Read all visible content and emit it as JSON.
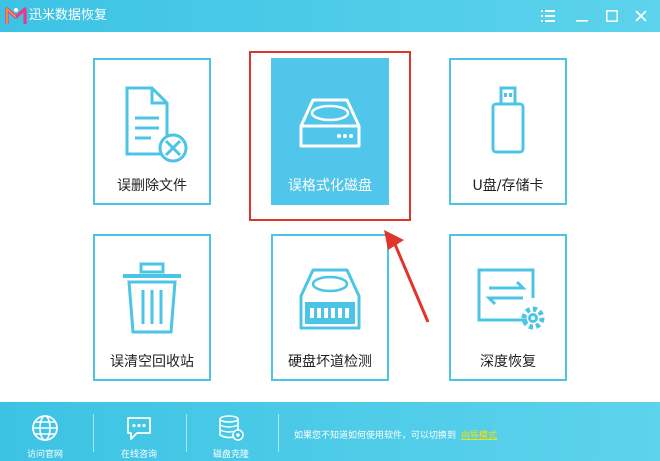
{
  "app": {
    "title": "迅米数据恢复"
  },
  "colors": {
    "accent": "#4cc4e6",
    "selected_fill": "#50c6ea",
    "highlight": "#e0352b",
    "link": "#f7e100"
  },
  "window_controls": [
    {
      "name": "menu",
      "icon": "hamburger-menu-icon"
    },
    {
      "name": "minimize",
      "icon": "minimize-icon"
    },
    {
      "name": "maximize",
      "icon": "maximize-icon"
    },
    {
      "name": "close",
      "icon": "close-icon"
    }
  ],
  "tiles": [
    {
      "label": "误删除文件",
      "icon": "deleted-file-icon",
      "selected": false
    },
    {
      "label": "误格式化磁盘",
      "icon": "hard-drive-icon",
      "selected": true
    },
    {
      "label": "U盘/存储卡",
      "icon": "usb-drive-icon",
      "selected": false
    },
    {
      "label": "误清空回收站",
      "icon": "trash-icon",
      "selected": false
    },
    {
      "label": "硬盘坏道检测",
      "icon": "disk-check-icon",
      "selected": false
    },
    {
      "label": "深度恢复",
      "icon": "deep-recovery-icon",
      "selected": false
    }
  ],
  "footer": {
    "buttons": [
      {
        "label": "访问官网",
        "icon": "globe-icon"
      },
      {
        "label": "在线咨询",
        "icon": "chat-icon"
      },
      {
        "label": "磁盘克隆",
        "icon": "disk-clone-icon"
      }
    ],
    "hint_text": "如果您不知道如何使用软件，可以切换到",
    "guide_link": "向导模式"
  }
}
